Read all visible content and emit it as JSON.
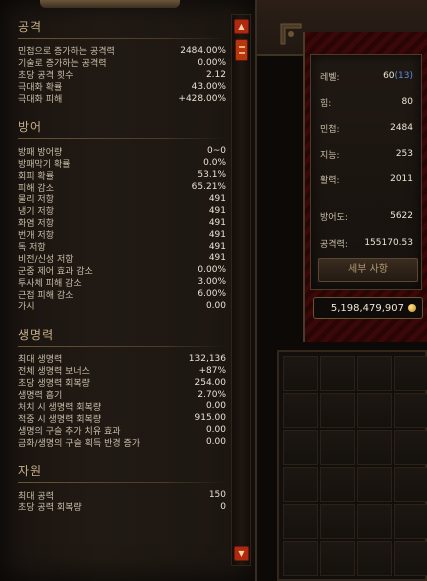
{
  "sections": [
    {
      "title": "공격",
      "rows": [
        {
          "label": "민첩으로 증가하는 공격력",
          "value": "2484.00%"
        },
        {
          "label": "기술로 증가하는 공격력",
          "value": "0.00%"
        },
        {
          "label": "초당 공격 횟수",
          "value": "2.12"
        },
        {
          "label": "극대화 확률",
          "value": "43.00%"
        },
        {
          "label": "극대화 피해",
          "value": "+428.00%"
        }
      ]
    },
    {
      "title": "방어",
      "rows": [
        {
          "label": "방패 방어량",
          "value": "0~0"
        },
        {
          "label": "방패막기 확률",
          "value": "0.0%"
        },
        {
          "label": "회피 확률",
          "value": "53.1%"
        },
        {
          "label": "피해 감소",
          "value": "65.21%"
        },
        {
          "label": "물리 저항",
          "value": "491"
        },
        {
          "label": "냉기 저항",
          "value": "491"
        },
        {
          "label": "화염 저항",
          "value": "491"
        },
        {
          "label": "번개 저항",
          "value": "491"
        },
        {
          "label": "독 저항",
          "value": "491"
        },
        {
          "label": "비전/신성 저항",
          "value": "491"
        },
        {
          "label": "군중 제어 효과 감소",
          "value": "0.00%"
        },
        {
          "label": "투사체 피해 감소",
          "value": "3.00%"
        },
        {
          "label": "근접 피해 감소",
          "value": "6.00%"
        },
        {
          "label": "가시",
          "value": "0.00"
        }
      ]
    },
    {
      "title": "생명력",
      "rows": [
        {
          "label": "최대 생명력",
          "value": "132,136"
        },
        {
          "label": "전체 생명력 보너스",
          "value": "+87%"
        },
        {
          "label": "초당 생명력 회복량",
          "value": "254.00"
        },
        {
          "label": "생명력 흡기",
          "value": "2.70%"
        },
        {
          "label": "처치 시 생명력 회복량",
          "value": "0.00"
        },
        {
          "label": "적중 시 생명력 회복량",
          "value": "915.00"
        },
        {
          "label": "생명의 구슬 추가 치유 효과",
          "value": "0.00"
        },
        {
          "label": "금화/생명의 구슬 획득 반경 증가",
          "value": "0.00"
        }
      ]
    },
    {
      "title": "자원",
      "rows": [
        {
          "label": "최대 공력",
          "value": "150"
        },
        {
          "label": "초당 공력 회복량",
          "value": "0"
        }
      ]
    }
  ],
  "character": {
    "level_label": "레벨:",
    "level_value": "60",
    "paragon_value": "(13)",
    "strength_label": "힘:",
    "strength_value": "80",
    "dexterity_label": "민첩:",
    "dexterity_value": "2484",
    "intelligence_label": "지능:",
    "intelligence_value": "253",
    "vitality_label": "활력:",
    "vitality_value": "2011",
    "armor_label": "방어도:",
    "armor_value": "5622",
    "damage_label": "공격력:",
    "damage_value": "155170.53",
    "details_button_label": "세부 사항"
  },
  "gold": "5,198,479,907",
  "icons": {
    "scroll_up": "arrow-up-icon",
    "scroll_down": "arrow-down-icon",
    "gold": "gold-coin-icon"
  },
  "colors": {
    "accent_red": "#b02810",
    "paragon_blue": "#5c8ee8",
    "section_title": "#c7b089"
  }
}
